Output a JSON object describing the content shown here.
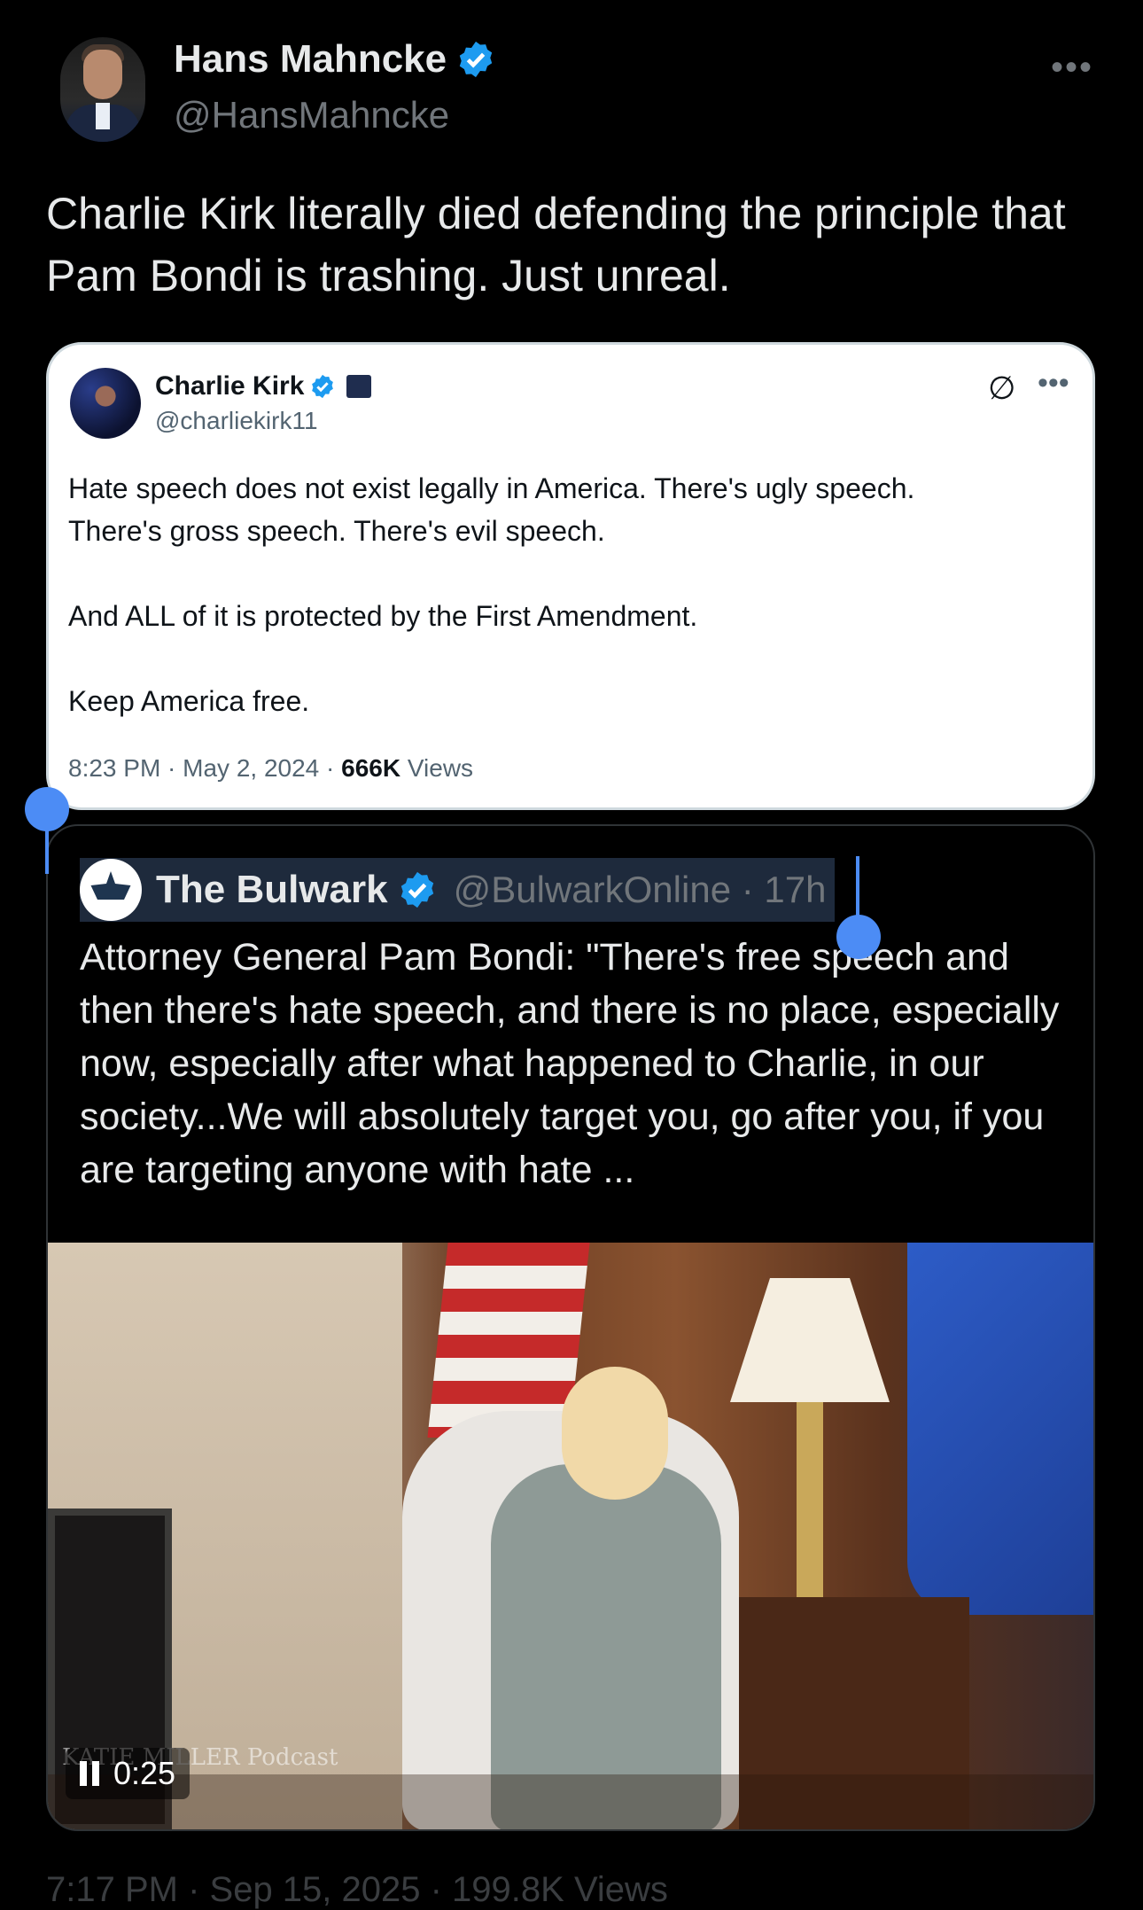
{
  "author": {
    "name": "Hans Mahncke",
    "handle": "@HansMahncke",
    "more": "•••"
  },
  "tweet": {
    "text": "Charlie Kirk literally died defending the principle that Pam Bondi is trashing. Just unreal."
  },
  "embedded_card": {
    "name": "Charlie Kirk",
    "handle": "@charliekirk11",
    "more": "•••",
    "grok_icon": "∅",
    "lines": [
      "Hate speech does not exist legally in America. There's ugly speech.",
      "There's gross speech. There's evil speech.",
      "And ALL of it is protected by the First Amendment.",
      "Keep America free."
    ],
    "time": "8:23 PM · May 2, 2024 · ",
    "views_count": "666K",
    "views_label": " Views"
  },
  "quote": {
    "name": "The Bulwark",
    "handle": "@BulwarkOnline · 17h",
    "text": "Attorney General Pam Bondi: \"There's free speech and then there's hate speech, and there is no place, especially now, especially after what happened to Charlie, in our society...We will absolutely target you, go after you, if you are targeting anyone with hate ...",
    "video_time": "0:25",
    "watermark": "KATIE MILLER Podcast"
  },
  "footer": {
    "partial": "7:17 PM · Sep 15, 2025 · 199.8K Views"
  },
  "colors": {
    "background": "#000000",
    "verified": "#1d9bf0",
    "selection": "#4c8cf5"
  }
}
